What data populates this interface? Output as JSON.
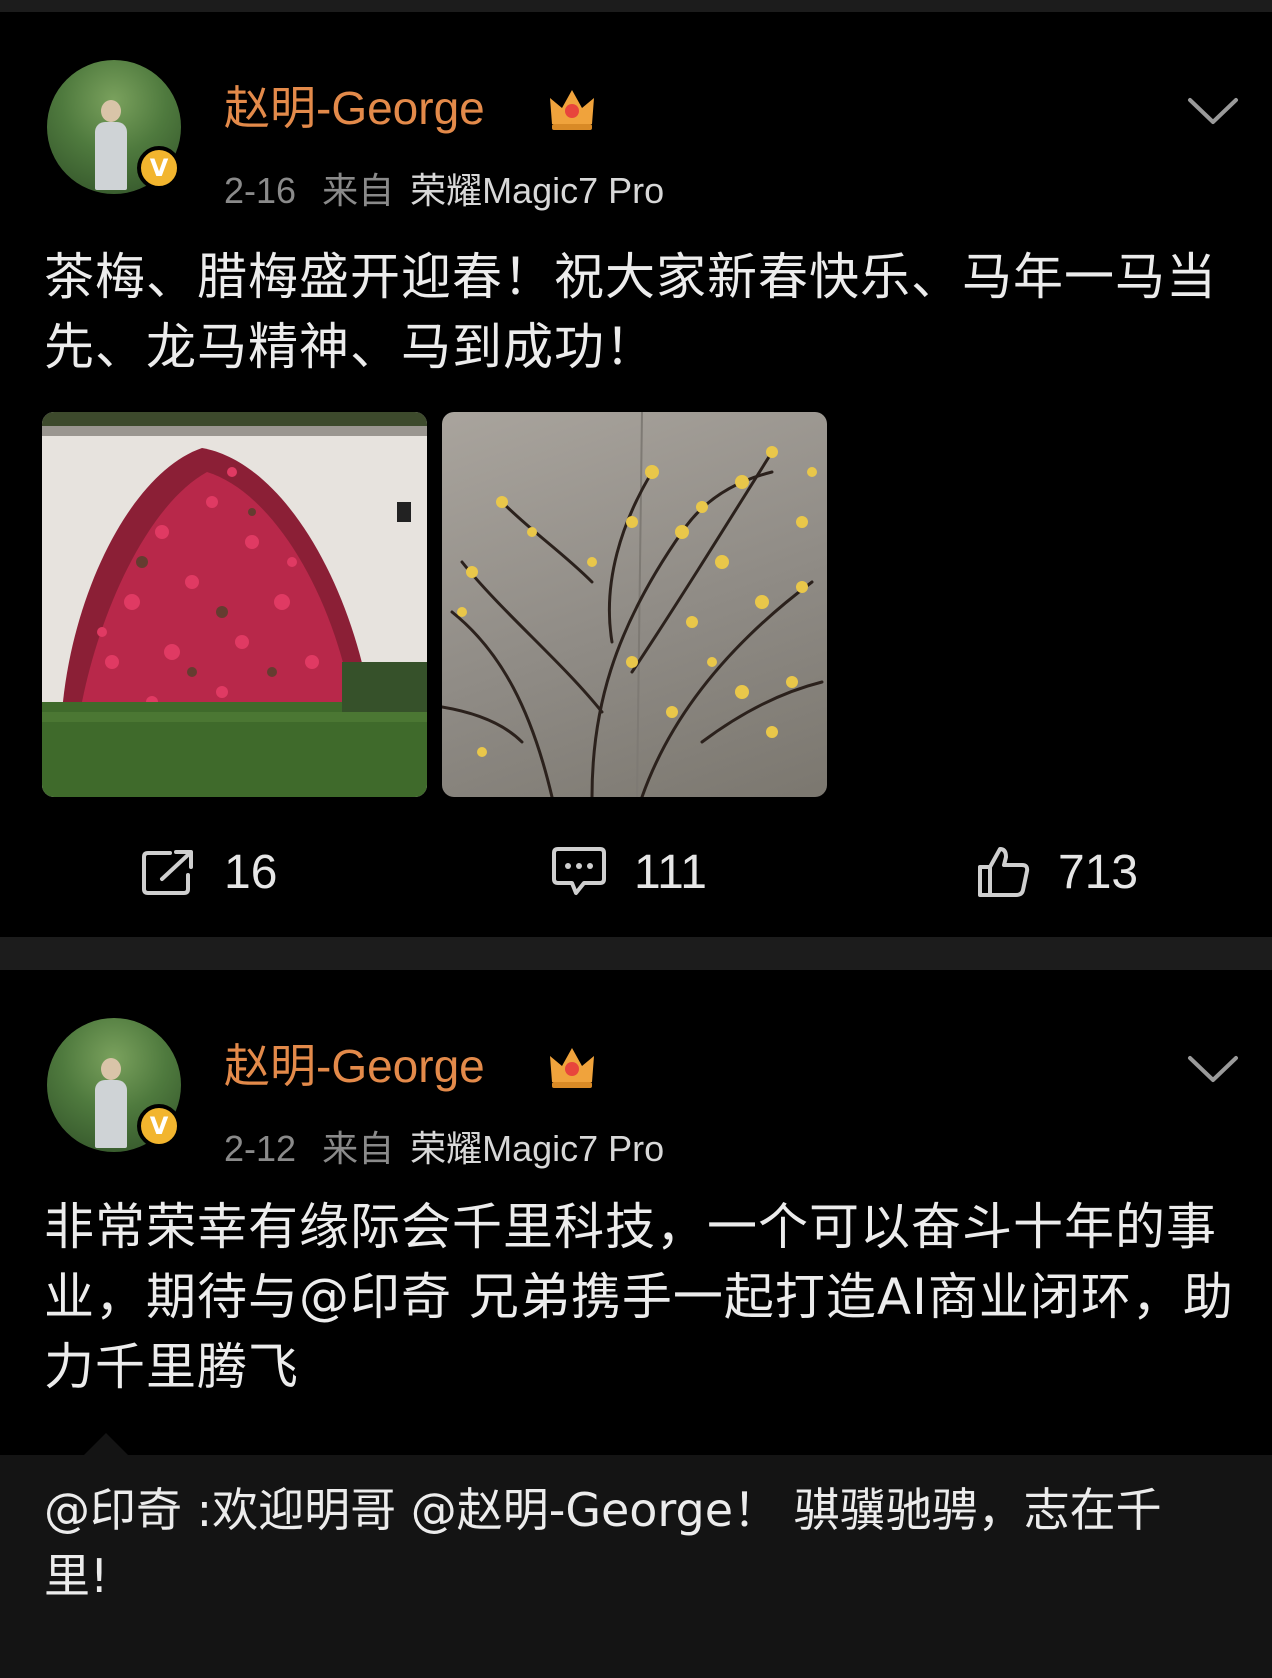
{
  "posts": [
    {
      "username": "赵明-George",
      "date": "2-16",
      "source_prefix": "来自",
      "device": "荣耀Magic7 Pro",
      "text": "茶梅、腊梅盛开迎春！祝大家新春快乐、马年一马当先、龙马精神、马到成功！",
      "images": [
        "camellia-photo",
        "wintersweet-photo"
      ],
      "reposts": "16",
      "comments": "111",
      "likes": "713"
    },
    {
      "username": "赵明-George",
      "date": "2-12",
      "source_prefix": "来自",
      "device": "荣耀Magic7 Pro",
      "text": "非常荣幸有缘际会千里科技，一个可以奋斗十年的事业，期待与@印奇 兄弟携手一起打造AI商业闭环，助力千里腾飞",
      "quote": "@印奇 :欢迎明哥 @赵明-George！ 骐骥驰骋，志在千里!"
    }
  ],
  "verified_badge": "V",
  "colors": {
    "background": "#000000",
    "separator": "#1c1c1c",
    "username": "#e38a4a",
    "badge": "#f2b52e",
    "meta": "#8a8a8a",
    "quote_bg": "#141414"
  },
  "icons": [
    "crown-icon",
    "verified-badge-icon",
    "chevron-down-icon",
    "repost-icon",
    "comment-icon",
    "like-icon"
  ]
}
